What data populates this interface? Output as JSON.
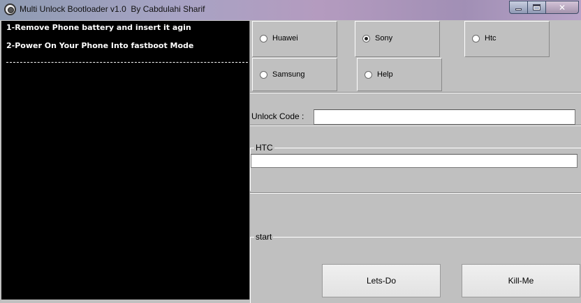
{
  "window": {
    "title": "Multi Unlock Bootloader v1.0  By Cabdulahi Sharif",
    "icon": "gear-icon",
    "controls": {
      "minimize": "minimize-icon",
      "maximize": "maximize-icon",
      "close": "✕"
    }
  },
  "console": {
    "lines": [
      "1-Remove Phone battery and insert it agin",
      "2-Power On Your Phone Into fastboot Mode"
    ]
  },
  "brands": {
    "huawei": "Huawei",
    "sony": "Sony",
    "htc": "Htc",
    "samsung": "Samsung",
    "help": "Help",
    "selected": "Sony"
  },
  "unlock": {
    "label": "Unlock Code :",
    "value": ""
  },
  "htc_group": {
    "label": "HTC",
    "value": ""
  },
  "start_group": {
    "label": "start"
  },
  "buttons": {
    "lets_do": "Lets-Do",
    "kill_me": "Kill-Me"
  }
}
